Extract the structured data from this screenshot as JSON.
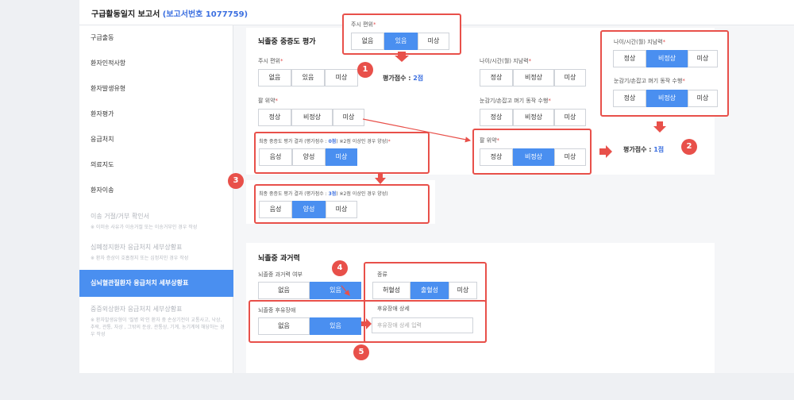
{
  "header": {
    "title": "구급활동일지 보고서",
    "report": "(보고서번호 1077759)"
  },
  "sidebar": {
    "items": [
      {
        "label": "구급출동"
      },
      {
        "label": "환자인적사항"
      },
      {
        "label": "환자발생유형"
      },
      {
        "label": "환자평가"
      },
      {
        "label": "응급처치"
      },
      {
        "label": "의료지도"
      },
      {
        "label": "환자이송"
      },
      {
        "label": "이송 거절/거부 확인서",
        "sub": "※ 이미송 사유가 이송거절 또는 이송거부인 경우 작성"
      },
      {
        "label": "심폐정지환자 응급처치 세부상황표",
        "sub": "※ 환자 증상이 호흡정지 또는 심정지인 경우 작성"
      },
      {
        "label": "심뇌혈관질환자 응급처치 세부상황표"
      },
      {
        "label": "중증외상환자 응급처치 세부상황표",
        "sub": "※ 환자발생유형이 '질병 외'인 환자 중 손상기전이 교통사고, 낙상, 추락, 관통, 자상 , 그밖의 둔상, 관통상, 기계, 농기계에 해당하는 경우 작성"
      }
    ]
  },
  "stroke": {
    "title": "뇌졸중 중증도 평가",
    "facial": {
      "label": "주시 편위",
      "opts": [
        "없음",
        "있음",
        "미상"
      ]
    },
    "score1": {
      "label": "평가점수 :",
      "value": "2점"
    },
    "arm": {
      "label": "팔 위약",
      "opts": [
        "정상",
        "비정상",
        "미상"
      ]
    },
    "age": {
      "label": "나이/시간(월) 지남력",
      "opts": [
        "정상",
        "비정상",
        "미상"
      ]
    },
    "grip": {
      "label": "눈감기/손잡고 펴기 동작 수행",
      "opts": [
        "정상",
        "비정상",
        "미상"
      ]
    },
    "final_a": {
      "label": "최종 중증도 평가 결과 (평가점수 : ",
      "score": "0점",
      "note": ") ※2점 이상인 경우 양성)",
      "opts": [
        "음성",
        "양성",
        "미상"
      ]
    },
    "final_b": {
      "label": "최종 중증도 평가 결과 (평가점수 : ",
      "score": "3점",
      "note": ") ※2점 이상인 경우 양성)",
      "opts": [
        "음성",
        "양성",
        "미상"
      ]
    },
    "score2": {
      "label": "평가점수 :",
      "value": "1점"
    }
  },
  "popups": {
    "p1": {
      "label": "주시 편위",
      "opts": [
        "없음",
        "있음",
        "미상"
      ]
    },
    "p2a": {
      "label": "나이/시간(월) 지남력",
      "opts": [
        "정상",
        "비정상",
        "미상"
      ]
    },
    "p2b": {
      "label": "눈감기/손잡고 펴기 동작 수행",
      "opts": [
        "정상",
        "비정상",
        "미상"
      ]
    }
  },
  "history": {
    "title": "뇌졸중 과거력",
    "has": {
      "label": "뇌졸중 과거력 여부",
      "opts": [
        "없음",
        "있음"
      ]
    },
    "type": {
      "label": "종류",
      "opts": [
        "허혈성",
        "출혈성",
        "미상"
      ]
    },
    "sequela": {
      "label": "뇌졸중 후유장애",
      "opts": [
        "없음",
        "있음"
      ]
    },
    "detail": {
      "label": "후유장애 상세",
      "placeholder": "후유장애 상세 입력"
    }
  },
  "badges": [
    "1",
    "2",
    "3",
    "4",
    "5"
  ],
  "colors": {
    "accent": "#4a8ff0",
    "highlight": "#e8504a"
  }
}
